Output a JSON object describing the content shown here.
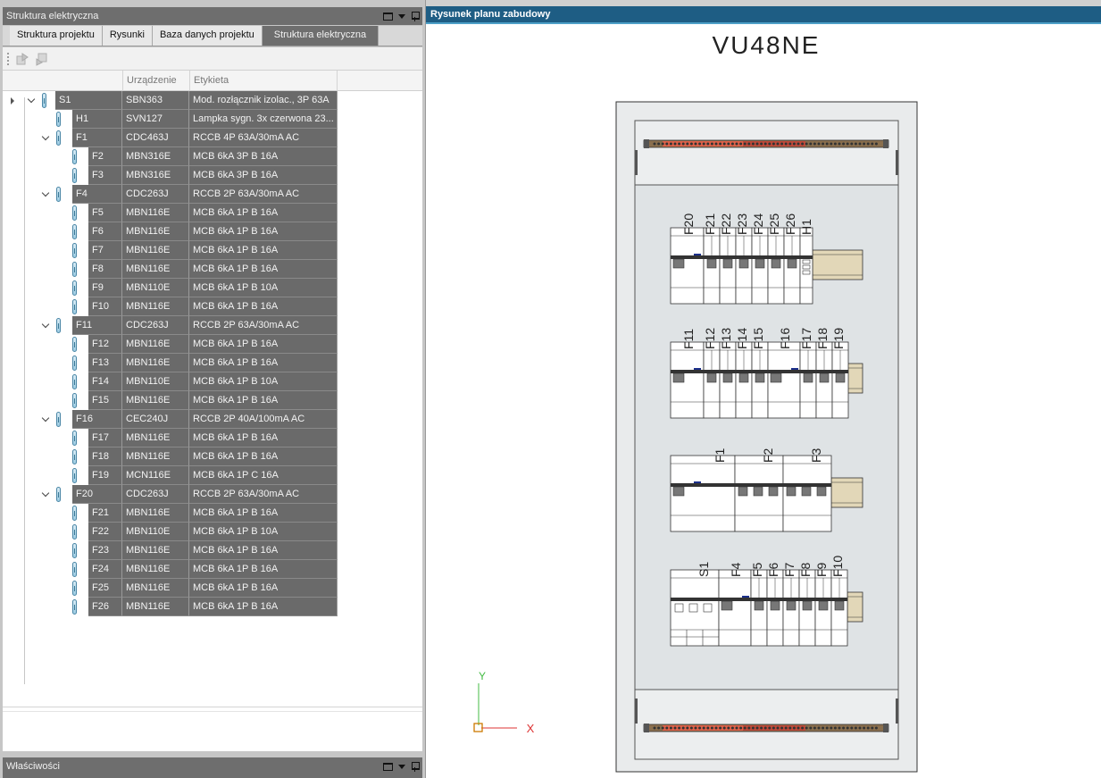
{
  "left_panel": {
    "title": "Struktura elektryczna",
    "tabs": [
      {
        "label": "Struktura projektu",
        "active": false
      },
      {
        "label": "Rysunki",
        "active": false
      },
      {
        "label": "Baza danych projektu",
        "active": false
      },
      {
        "label": "Struktura elektryczna",
        "active": true
      }
    ],
    "columns": {
      "device": "Urządzenie",
      "label": "Etykieta"
    },
    "rows": [
      {
        "name": "S1",
        "level": 0,
        "expanded": true,
        "device": "SBN363",
        "label": "Mod. rozłącznik izolac., 3P 63A"
      },
      {
        "name": "H1",
        "level": 1,
        "device": "SVN127",
        "label": "Lampka sygn. 3x czerwona 23..."
      },
      {
        "name": "F1",
        "level": 1,
        "expanded": true,
        "device": "CDC463J",
        "label": "RCCB 4P 63A/30mA AC"
      },
      {
        "name": "F2",
        "level": 2,
        "device": "MBN316E",
        "label": "MCB 6kA 3P B 16A"
      },
      {
        "name": "F3",
        "level": 2,
        "device": "MBN316E",
        "label": "MCB 6kA 3P B 16A"
      },
      {
        "name": "F4",
        "level": 1,
        "expanded": true,
        "device": "CDC263J",
        "label": "RCCB 2P 63A/30mA AC"
      },
      {
        "name": "F5",
        "level": 2,
        "device": "MBN116E",
        "label": "MCB 6kA 1P B 16A"
      },
      {
        "name": "F6",
        "level": 2,
        "device": "MBN116E",
        "label": "MCB 6kA 1P B 16A"
      },
      {
        "name": "F7",
        "level": 2,
        "device": "MBN116E",
        "label": "MCB 6kA 1P B 16A"
      },
      {
        "name": "F8",
        "level": 2,
        "device": "MBN116E",
        "label": "MCB 6kA 1P B 16A"
      },
      {
        "name": "F9",
        "level": 2,
        "device": "MBN110E",
        "label": "MCB 6kA 1P B 10A"
      },
      {
        "name": "F10",
        "level": 2,
        "device": "MBN116E",
        "label": "MCB 6kA 1P B 16A"
      },
      {
        "name": "F11",
        "level": 1,
        "expanded": true,
        "device": "CDC263J",
        "label": "RCCB 2P 63A/30mA AC"
      },
      {
        "name": "F12",
        "level": 2,
        "device": "MBN116E",
        "label": "MCB 6kA 1P B 16A"
      },
      {
        "name": "F13",
        "level": 2,
        "device": "MBN116E",
        "label": "MCB 6kA 1P B 16A"
      },
      {
        "name": "F14",
        "level": 2,
        "device": "MBN110E",
        "label": "MCB 6kA 1P B 10A"
      },
      {
        "name": "F15",
        "level": 2,
        "device": "MBN116E",
        "label": "MCB 6kA 1P B 16A"
      },
      {
        "name": "F16",
        "level": 1,
        "expanded": true,
        "device": "CEC240J",
        "label": "RCCB 2P 40A/100mA AC"
      },
      {
        "name": "F17",
        "level": 2,
        "device": "MBN116E",
        "label": "MCB 6kA 1P B 16A"
      },
      {
        "name": "F18",
        "level": 2,
        "device": "MBN116E",
        "label": "MCB 6kA 1P B 16A"
      },
      {
        "name": "F19",
        "level": 2,
        "device": "MCN116E",
        "label": "MCB 6kA 1P C 16A"
      },
      {
        "name": "F20",
        "level": 1,
        "expanded": true,
        "device": "CDC263J",
        "label": "RCCB 2P 63A/30mA AC"
      },
      {
        "name": "F21",
        "level": 2,
        "device": "MBN116E",
        "label": "MCB 6kA 1P B 16A"
      },
      {
        "name": "F22",
        "level": 2,
        "device": "MBN110E",
        "label": "MCB 6kA 1P B 10A"
      },
      {
        "name": "F23",
        "level": 2,
        "device": "MBN116E",
        "label": "MCB 6kA 1P B 16A"
      },
      {
        "name": "F24",
        "level": 2,
        "device": "MBN116E",
        "label": "MCB 6kA 1P B 16A"
      },
      {
        "name": "F25",
        "level": 2,
        "device": "MBN116E",
        "label": "MCB 6kA 1P B 16A"
      },
      {
        "name": "F26",
        "level": 2,
        "device": "MBN116E",
        "label": "MCB 6kA 1P B 16A"
      }
    ]
  },
  "properties_panel": {
    "title": "Właściwości"
  },
  "drawing_panel": {
    "title": "Rysunek planu zabudowy",
    "enclosure_name": "VU48NE",
    "axis": {
      "y": "Y",
      "x": "X"
    },
    "colors": {
      "axis_y": "#44bb44",
      "axis_x": "#dd3333",
      "rail_accent": "#e0624a",
      "panel_fill": "#dfe3e5"
    },
    "din_rows": [
      {
        "labels": [
          "F20",
          "F21",
          "F22",
          "F23",
          "F24",
          "F25",
          "F26",
          "H1"
        ]
      },
      {
        "labels": [
          "F11",
          "F12",
          "F13",
          "F14",
          "F15",
          "F16",
          "F17",
          "F18",
          "F19"
        ]
      },
      {
        "labels": [
          "F1",
          "F2",
          "F3"
        ]
      },
      {
        "labels": [
          "S1",
          "F4",
          "F5",
          "F6",
          "F7",
          "F8",
          "F9",
          "F10"
        ]
      }
    ]
  }
}
